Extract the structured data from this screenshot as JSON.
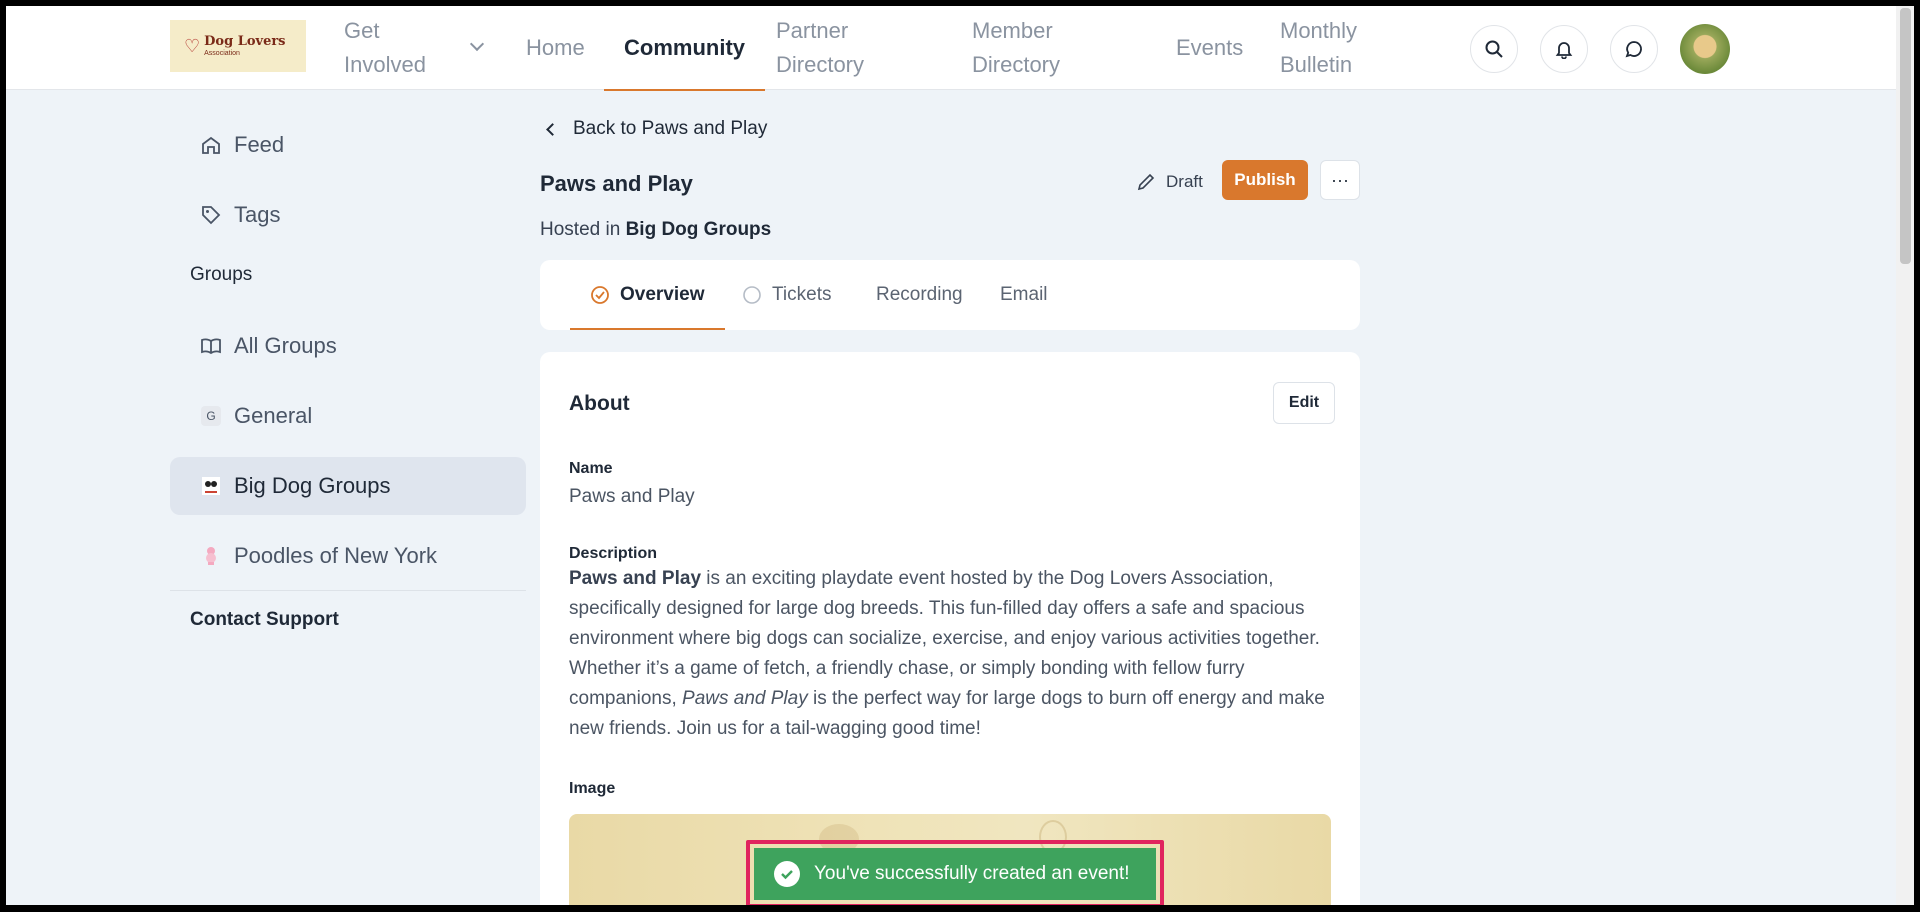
{
  "logo": {
    "line1": "Dog Lovers",
    "line2": "Association"
  },
  "nav": {
    "get_involved": "Get Involved",
    "home": "Home",
    "community": "Community",
    "partner_directory": "Partner Directory",
    "member_directory": "Member Directory",
    "events": "Events",
    "monthly_bulletin": "Monthly Bulletin"
  },
  "sidebar": {
    "feed": "Feed",
    "tags": "Tags",
    "groups_heading": "Groups",
    "all_groups": "All Groups",
    "general_badge": "G",
    "general": "General",
    "big_dog_groups": "Big Dog Groups",
    "poodles": "Poodles of New York",
    "contact_support": "Contact Support"
  },
  "event": {
    "back_label": "Back to Paws and Play",
    "title": "Paws and Play",
    "hosted_prefix": "Hosted in",
    "hosted_group": "Big Dog Groups",
    "draft_label": "Draft",
    "publish_label": "Publish",
    "more_label": "···"
  },
  "tabs": {
    "overview": "Overview",
    "tickets": "Tickets",
    "recording": "Recording",
    "email": "Email"
  },
  "about": {
    "title": "About",
    "edit_label": "Edit",
    "name_label": "Name",
    "name_value": "Paws and Play",
    "description_label": "Description",
    "desc_bold": "Paws and Play",
    "desc_part1": " is an exciting playdate event hosted by the Dog Lovers Association, specifically designed for large dog breeds. This fun-filled day offers a safe and spacious environment where big dogs can socialize, exercise, and enjoy various activities together. Whether it’s a game of fetch, a friendly chase, or simply bonding with fellow furry companions, ",
    "desc_italic": "Paws and Play",
    "desc_part2": " is the perfect way for large dogs to burn off energy and make new friends. Join us for a tail-wagging good time!",
    "image_label": "Image"
  },
  "toast": {
    "message": "You've successfully created an event!"
  },
  "colors": {
    "accent": "#d9782d",
    "success": "#3ea35d",
    "highlight": "#e0245e"
  }
}
